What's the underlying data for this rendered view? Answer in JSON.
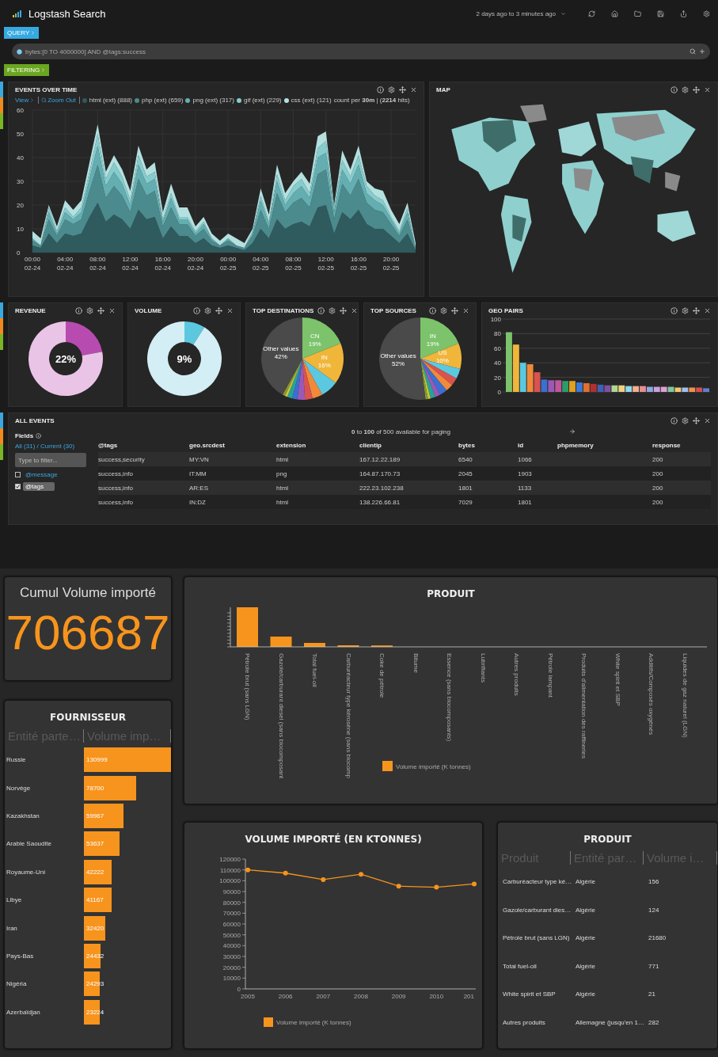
{
  "header": {
    "title": "Logstash Search",
    "time_range": "2 days ago to 3 minutes ago"
  },
  "query": {
    "tab": "QUERY",
    "value": "bytes:[0 TO 4000000] AND @tags:success"
  },
  "filtering": {
    "tab": "FILTERING"
  },
  "events_over_time": {
    "title": "EVENTS OVER TIME",
    "view": "View",
    "zoom_out": "Zoom Out",
    "summary": "count per **30m** | (**2214** hits)",
    "chart_data": {
      "type": "area",
      "stacked": true,
      "grid": true,
      "categories": [
        "00:00 02-24",
        null,
        null,
        null,
        "04:00 02-24",
        null,
        null,
        null,
        "08:00 02-24",
        null,
        null,
        null,
        "12:00 02-24",
        null,
        null,
        null,
        "16:00 02-24",
        null,
        null,
        null,
        "20:00 02-24",
        null,
        null,
        null,
        "00:00 02-25",
        null,
        null,
        null,
        "04:00 02-25",
        null,
        null,
        null,
        "08:00 02-25",
        null,
        null,
        null,
        "12:00 02-25",
        null,
        null,
        null,
        "16:00 02-25",
        null,
        null,
        null,
        "20:00 02-25",
        null,
        null,
        null
      ],
      "ylim": [
        0,
        60
      ],
      "yticks": [
        0,
        10,
        20,
        30,
        40,
        50,
        60
      ],
      "series": [
        {
          "name": "html (ext) (888)",
          "color": "#2f5a5e",
          "values": [
            3,
            2,
            8,
            4,
            8,
            7,
            8,
            15,
            21,
            13,
            16,
            14,
            10,
            18,
            14,
            15,
            6,
            11,
            7,
            7,
            4,
            6,
            3,
            2,
            3,
            2,
            1,
            4,
            10,
            6,
            14,
            10,
            12,
            13,
            11,
            19,
            20,
            8,
            17,
            14,
            18,
            12,
            10,
            10,
            7,
            4,
            8,
            1
          ]
        },
        {
          "name": "php (ext) (659)",
          "color": "#4b8a8d",
          "values": [
            2,
            1,
            6,
            3,
            6,
            5,
            6,
            11,
            16,
            10,
            12,
            10,
            7,
            13,
            10,
            11,
            5,
            8,
            5,
            5,
            3,
            4,
            2,
            1,
            2,
            1,
            1,
            3,
            8,
            4,
            11,
            7,
            9,
            10,
            8,
            14,
            15,
            6,
            12,
            10,
            13,
            9,
            8,
            7,
            5,
            3,
            6,
            1
          ]
        },
        {
          "name": "png (ext) (317)",
          "color": "#64aeb1",
          "values": [
            1,
            0,
            3,
            1,
            3,
            2,
            3,
            5,
            8,
            5,
            6,
            5,
            3,
            6,
            5,
            5,
            2,
            4,
            2,
            2,
            1,
            2,
            1,
            0,
            1,
            0,
            0,
            1,
            4,
            2,
            5,
            3,
            4,
            5,
            4,
            7,
            7,
            3,
            6,
            5,
            6,
            4,
            4,
            3,
            2,
            1,
            3,
            0
          ]
        },
        {
          "name": "gif (ext) (229)",
          "color": "#86cccd",
          "values": [
            0,
            0,
            2,
            1,
            2,
            1,
            2,
            3,
            5,
            3,
            4,
            3,
            2,
            4,
            3,
            3,
            1,
            2,
            1,
            1,
            1,
            1,
            0,
            0,
            0,
            0,
            0,
            1,
            2,
            1,
            3,
            2,
            3,
            3,
            2,
            4,
            5,
            2,
            4,
            3,
            4,
            3,
            2,
            2,
            1,
            1,
            2,
            0
          ]
        },
        {
          "name": "css (ext) (121)",
          "color": "#b4e0e0",
          "values": [
            3,
            3,
            1,
            2,
            3,
            3,
            3,
            4,
            4,
            3,
            3,
            3,
            4,
            4,
            3,
            4,
            3,
            4,
            4,
            4,
            2,
            2,
            2,
            2,
            2,
            3,
            2,
            1,
            3,
            3,
            4,
            3,
            2,
            3,
            4,
            5,
            4,
            1,
            4,
            3,
            4,
            2,
            3,
            4,
            3,
            3,
            2,
            2
          ]
        }
      ]
    }
  },
  "map": {
    "title": "MAP"
  },
  "panels": [
    {
      "kind": "gauge",
      "title": "REVENUE",
      "reading": "22%",
      "chart_data": {
        "type": "donut",
        "values": [
          22,
          78
        ],
        "colors": [
          "#b84bb0",
          "#e9c4e6"
        ]
      }
    },
    {
      "kind": "gauge",
      "title": "VOLUME",
      "reading": "9%",
      "chart_data": {
        "type": "donut",
        "values": [
          9,
          91
        ],
        "colors": [
          "#5bc8e0",
          "#d3eef4"
        ]
      }
    },
    {
      "kind": "pie",
      "title": "TOP DESTINATIONS",
      "chart_data": {
        "type": "pie",
        "categories": [
          "CN",
          "IN",
          null,
          null,
          null,
          null,
          null,
          null,
          null,
          null,
          "Other values"
        ],
        "values": [
          19,
          16,
          7,
          4,
          3,
          3,
          2,
          2,
          1,
          1,
          42
        ],
        "colors": [
          "#7cc36b",
          "#f0b63a",
          "#5bc8e0",
          "#f08a3a",
          "#d9534f",
          "#9b59b6",
          "#3b6fd1",
          "#2aa198",
          "#c8c83a",
          "#8a9a2a",
          "#4a4a4a"
        ],
        "value_labels": [
          "19%",
          "16%",
          null,
          null,
          null,
          null,
          null,
          null,
          null,
          null,
          "42%"
        ]
      }
    },
    {
      "kind": "pie",
      "title": "TOP SOURCES",
      "chart_data": {
        "type": "pie",
        "categories": [
          "IN",
          "US",
          null,
          null,
          null,
          null,
          null,
          null,
          null,
          null,
          "Other values"
        ],
        "values": [
          19,
          10,
          4,
          3,
          3,
          3,
          2,
          2,
          1,
          1,
          52
        ],
        "colors": [
          "#7cc36b",
          "#f0b63a",
          "#5bc8e0",
          "#d9534f",
          "#f08a3a",
          "#3b6fd1",
          "#9b59b6",
          "#2aa198",
          "#c8c83a",
          "#8a9a2a",
          "#4a4a4a"
        ],
        "value_labels": [
          "19%",
          "10%",
          null,
          null,
          null,
          null,
          null,
          null,
          null,
          null,
          "52%"
        ]
      }
    },
    {
      "kind": "bars",
      "title": "GEO PAIRS",
      "chart_data": {
        "type": "bar",
        "grid": true,
        "ylim": [
          0,
          100
        ],
        "yticks": [
          0,
          20,
          40,
          60,
          80,
          100
        ],
        "values": [
          82,
          65,
          40,
          38,
          27,
          17,
          16,
          16,
          15,
          15,
          13,
          12,
          11,
          10,
          9,
          9,
          9,
          8,
          8,
          8,
          7,
          7,
          7,
          7,
          6,
          6,
          6,
          6,
          5
        ],
        "colors": [
          "#7cc36b",
          "#f0b63a",
          "#5bc8e0",
          "#f08a3a",
          "#d9534f",
          "#3b6fd1",
          "#9b59b6",
          "#c0569c",
          "#2e9b6a",
          "#e0a020",
          "#3a7ad9",
          "#e07030",
          "#b03030",
          "#4060b0",
          "#8050a0",
          "#b0d890",
          "#f0d080",
          "#90d8f0",
          "#f0b090",
          "#e89090",
          "#90a8e0",
          "#c8a0e0",
          "#e0a0d0",
          "#80c8a0",
          "#f0c870",
          "#a0c0f0",
          "#f09050",
          "#d05050",
          "#6080d0"
        ]
      }
    }
  ],
  "all_events": {
    "title": "ALL EVENTS",
    "paging": "**0** to **100** of 500 available for paging",
    "fields_title": "Fields",
    "field_scope": "All (31) / Current (30)",
    "filter_placeholder": "Type to filter...",
    "fields": [
      {
        "name": "@message",
        "checked": false
      },
      {
        "name": "@tags",
        "checked": true
      }
    ],
    "columns": [
      "@tags",
      "geo.srcdest",
      "extension",
      "clientip",
      "bytes",
      "id",
      "phpmemory",
      "response"
    ],
    "rows": [
      [
        "success,security",
        "MY:VN",
        "html",
        "167.12.22.189",
        "6540",
        "1066",
        "",
        "200"
      ],
      [
        "success,info",
        "IT:MM",
        "png",
        "164.87.170.73",
        "2045",
        "1903",
        "",
        "200"
      ],
      [
        "success,info",
        "AR:ES",
        "html",
        "222.23.102.238",
        "1801",
        "1133",
        "",
        "200"
      ],
      [
        "success,info",
        "IN:DZ",
        "html",
        "138.226.66.81",
        "7029",
        "1801",
        "",
        "200"
      ]
    ]
  },
  "cumul": {
    "title": "Cumul Volume importé",
    "value": "706687"
  },
  "fournisseur": {
    "title": "FOURNISSEUR",
    "columns": [
      "Entité parte…",
      "Volume imp…"
    ],
    "rows": [
      {
        "name": "Russie",
        "value": "130999"
      },
      {
        "name": "Norvège",
        "value": "78700"
      },
      {
        "name": "Kazakhstan",
        "value": "59967"
      },
      {
        "name": "Arabie Saoudite",
        "value": "53637"
      },
      {
        "name": "Royaume-Uni",
        "value": "42222"
      },
      {
        "name": "Libye",
        "value": "41167"
      },
      {
        "name": "Iran",
        "value": "32420"
      },
      {
        "name": "Pays-Bas",
        "value": "24432"
      },
      {
        "name": "Nigéria",
        "value": "24293"
      },
      {
        "name": "Azerbaïdjan",
        "value": "23224"
      }
    ]
  },
  "produit_chart": {
    "title": "PRODUIT",
    "legend": "Volume importé (K tonnes)",
    "categories": [
      "Pétrole brut (sans LGN)",
      "Gazole/carburant diesel (sans biocomposant",
      "Total fuel-oil",
      "Carburéacteur type kérosène (sans biocomp",
      "Coke de pétrole",
      "Bitume",
      "Essence (sans biocomposants)",
      "Lubrifiants",
      "Autres produits",
      "Pétrole lampant",
      "Produits d'alimentation des raffineries",
      "White spirit et SBP",
      "Additifs/Composés oxygénés",
      "Liquides de gaz naturel (LGN)"
    ]
  },
  "volume_chart": {
    "title": "VOLUME IMPORTÉ (EN KTONNES)",
    "chart_data": {
      "type": "line",
      "marker": true,
      "categories": [
        "2005",
        "2006",
        "2007",
        "2008",
        "2009",
        "2010",
        "201"
      ],
      "ylim": [
        0,
        120000
      ],
      "yticks": [
        0,
        10000,
        20000,
        30000,
        40000,
        50000,
        60000,
        70000,
        80000,
        90000,
        100000,
        110000,
        120000
      ],
      "series": [
        {
          "name": "Volume importé (K tonnes)",
          "color": "#f7941d",
          "values": [
            110000,
            107000,
            101000,
            106000,
            95000,
            94000,
            97000
          ]
        }
      ]
    }
  },
  "produit_table": {
    "title": "PRODUIT",
    "columns": [
      "Produit",
      "Entité par…",
      "Volume i…"
    ],
    "rows": [
      [
        "Carburéacteur type ké…",
        "Algérie",
        "156"
      ],
      [
        "Gazole/carburant dies…",
        "Algérie",
        "124"
      ],
      [
        "Pétrole brut (sans LGN)",
        "Algérie",
        "21680"
      ],
      [
        "Total fuel-oil",
        "Algérie",
        "771"
      ],
      [
        "White spirit et SBP",
        "Algérie",
        "21"
      ],
      [
        "Autres produits",
        "Allemagne (jusqu'en 1…",
        "282"
      ]
    ]
  }
}
